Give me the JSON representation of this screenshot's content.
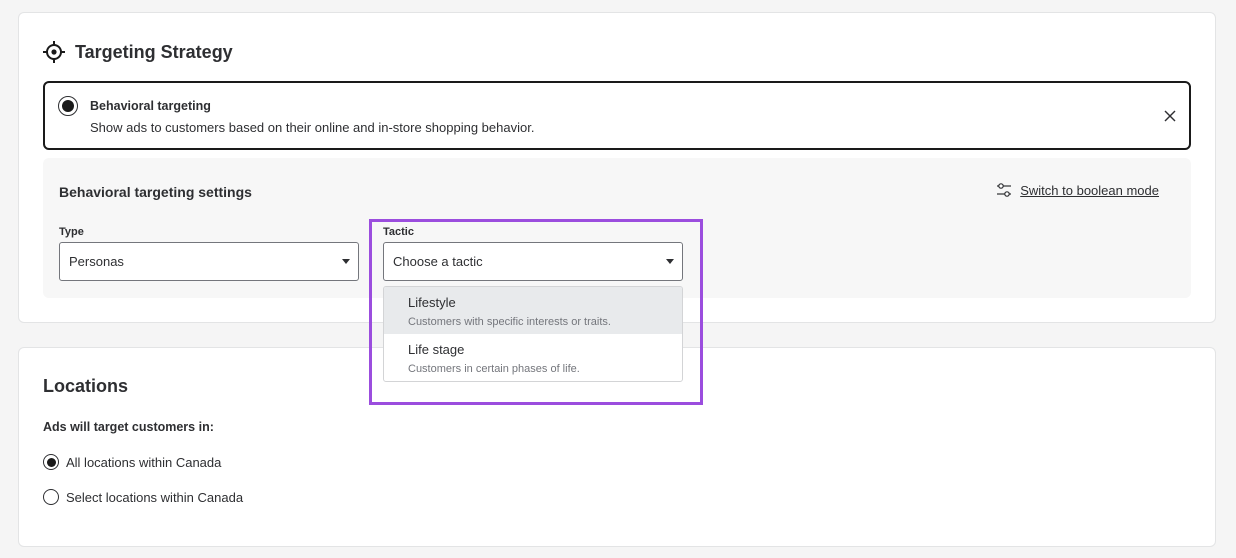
{
  "targeting": {
    "title": "Targeting Strategy",
    "title_icon": "crosshair-icon",
    "option": {
      "title": "Behavioral targeting",
      "description": "Show ads to customers based on their online and in-store shopping behavior.",
      "selected": true
    },
    "settings": {
      "title": "Behavioral targeting settings",
      "boolean_link": "Switch to boolean mode",
      "type": {
        "label": "Type",
        "value": "Personas"
      },
      "tactic": {
        "label": "Tactic",
        "placeholder": "Choose a tactic",
        "options": [
          {
            "title": "Lifestyle",
            "description": "Customers with specific interests or traits."
          },
          {
            "title": "Life stage",
            "description": "Customers in certain phases of life."
          }
        ]
      }
    }
  },
  "locations": {
    "title": "Locations",
    "subtitle": "Ads will target customers in:",
    "options": [
      {
        "label": "All locations within Canada",
        "selected": true
      },
      {
        "label": "Select locations within Canada",
        "selected": false
      }
    ]
  },
  "colors": {
    "highlight": "#9b4dde",
    "text": "#2e2f32",
    "panel": "#f7f7f7",
    "active_item": "#e8eaec"
  }
}
